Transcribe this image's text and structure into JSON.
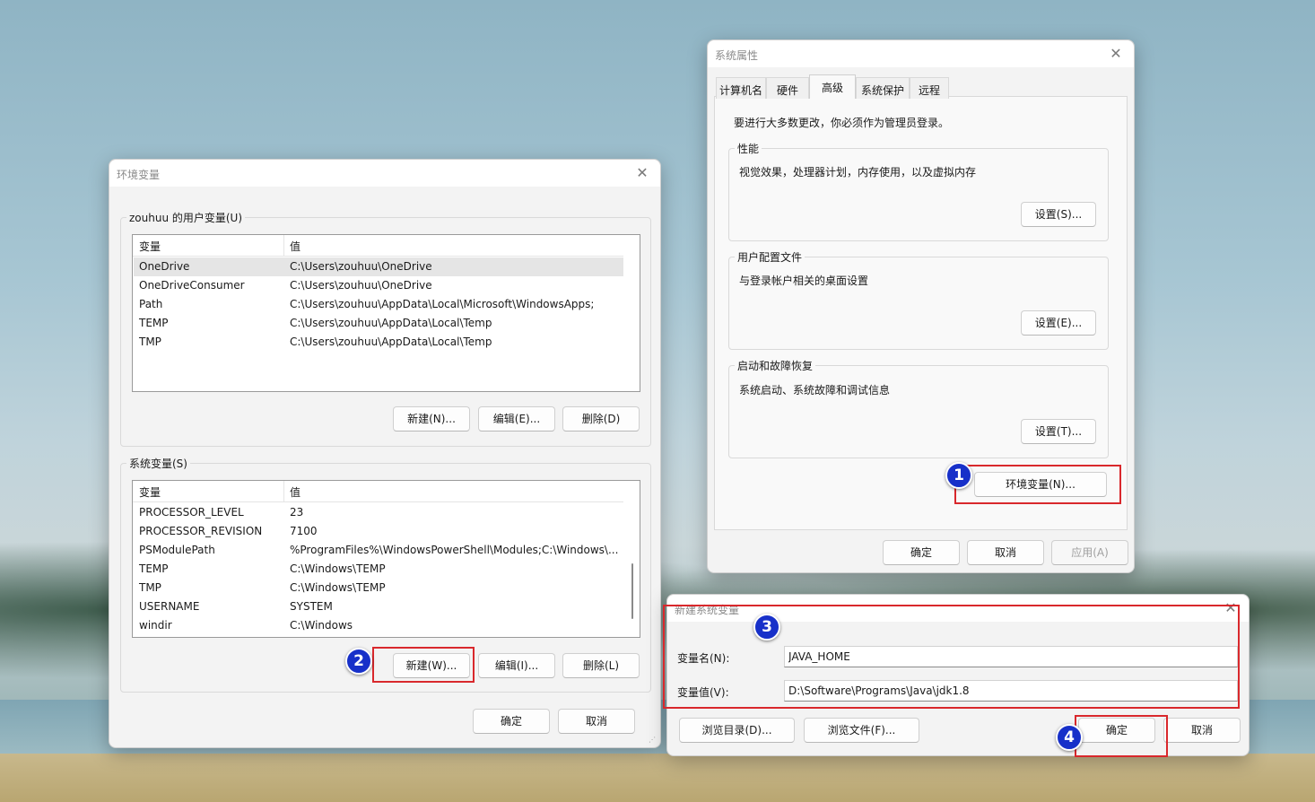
{
  "env_dialog": {
    "title": "环境变量",
    "user_group_label": "zouhuu 的用户变量(U)",
    "user_columns": [
      "变量",
      "值"
    ],
    "user_rows": [
      {
        "name": "OneDrive",
        "value": "C:\\Users\\zouhuu\\OneDrive",
        "selected": true
      },
      {
        "name": "OneDriveConsumer",
        "value": "C:\\Users\\zouhuu\\OneDrive"
      },
      {
        "name": "Path",
        "value": "C:\\Users\\zouhuu\\AppData\\Local\\Microsoft\\WindowsApps;"
      },
      {
        "name": "TEMP",
        "value": "C:\\Users\\zouhuu\\AppData\\Local\\Temp"
      },
      {
        "name": "TMP",
        "value": "C:\\Users\\zouhuu\\AppData\\Local\\Temp"
      }
    ],
    "user_buttons": {
      "new": "新建(N)...",
      "edit": "编辑(E)...",
      "delete": "删除(D)"
    },
    "system_group_label": "系统变量(S)",
    "system_columns": [
      "变量",
      "值"
    ],
    "system_rows": [
      {
        "name": "PROCESSOR_LEVEL",
        "value": "23"
      },
      {
        "name": "PROCESSOR_REVISION",
        "value": "7100"
      },
      {
        "name": "PSModulePath",
        "value": "%ProgramFiles%\\WindowsPowerShell\\Modules;C:\\Windows\\..."
      },
      {
        "name": "TEMP",
        "value": "C:\\Windows\\TEMP"
      },
      {
        "name": "TMP",
        "value": "C:\\Windows\\TEMP"
      },
      {
        "name": "USERNAME",
        "value": "SYSTEM"
      },
      {
        "name": "windir",
        "value": "C:\\Windows"
      }
    ],
    "system_buttons": {
      "new": "新建(W)...",
      "edit": "编辑(I)...",
      "delete": "删除(L)"
    },
    "ok": "确定",
    "cancel": "取消"
  },
  "sysprops_dialog": {
    "title": "系统属性",
    "tabs": [
      "计算机名",
      "硬件",
      "高级",
      "系统保护",
      "远程"
    ],
    "active_tab": "高级",
    "admin_note": "要进行大多数更改，你必须作为管理员登录。",
    "performance": {
      "label": "性能",
      "desc": "视觉效果，处理器计划，内存使用，以及虚拟内存",
      "button": "设置(S)..."
    },
    "profile": {
      "label": "用户配置文件",
      "desc": "与登录帐户相关的桌面设置",
      "button": "设置(E)..."
    },
    "startup": {
      "label": "启动和故障恢复",
      "desc": "系统启动、系统故障和调试信息",
      "button": "设置(T)..."
    },
    "env_button": "环境变量(N)...",
    "ok": "确定",
    "cancel": "取消",
    "apply": "应用(A)"
  },
  "new_var_dialog": {
    "title": "新建系统变量",
    "name_label": "变量名(N):",
    "name_value": "JAVA_HOME",
    "value_label": "变量值(V):",
    "value_value": "D:\\Software\\Programs\\Java\\jdk1.8",
    "browse_dir": "浏览目录(D)...",
    "browse_file": "浏览文件(F)...",
    "ok": "确定",
    "cancel": "取消"
  },
  "callouts": {
    "one": "1",
    "two": "2",
    "three": "3",
    "four": "4"
  },
  "colors": {
    "callout_border": "#d9282c",
    "badge_fill": "#1730c9"
  },
  "icons": {
    "close": "close-icon",
    "resize": "resize-grip-icon"
  }
}
